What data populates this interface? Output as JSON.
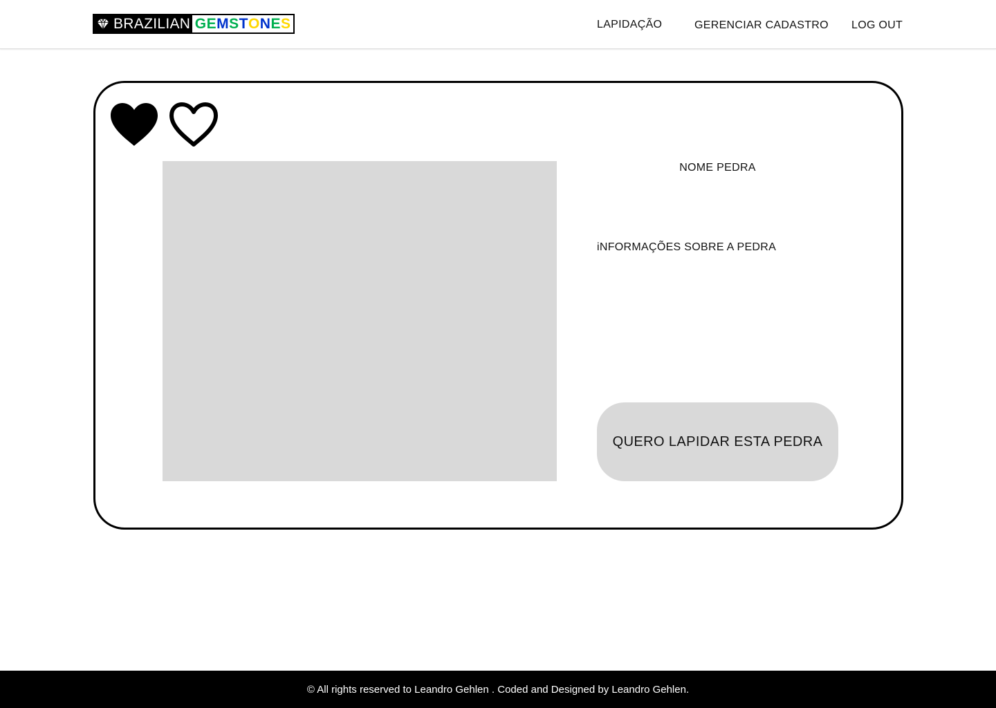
{
  "brand": {
    "word_left": "BRAZILIAN",
    "word_right_letters": [
      {
        "char": "G",
        "color": "#00b050"
      },
      {
        "char": "E",
        "color": "#00b050"
      },
      {
        "char": "M",
        "color": "#0033cc"
      },
      {
        "char": "S",
        "color": "#00b050"
      },
      {
        "char": "T",
        "color": "#0033cc"
      },
      {
        "char": "O",
        "color": "#ffd800"
      },
      {
        "char": "N",
        "color": "#0033cc"
      },
      {
        "char": "E",
        "color": "#00b050"
      },
      {
        "char": "S",
        "color": "#ffd800"
      }
    ],
    "icon": "diamond-icon"
  },
  "nav": {
    "lapidacao": "LAPIDAÇÃO",
    "gerenciar": "GERENCIAR CADASTRO",
    "logout": "LOG OUT"
  },
  "card": {
    "favorite_filled_icon": "heart-filled-icon",
    "favorite_outline_icon": "heart-outline-icon",
    "stone_name": "NOME PEDRA",
    "stone_info": "iNFORMAÇÕES SOBRE A PEDRA",
    "cta_label": "QUERO LAPIDAR ESTA PEDRA",
    "image_placeholder_color": "#d9d9d9"
  },
  "footer": {
    "text": "© All rights reserved to Leandro Gehlen . Coded  and Designed by Leandro Gehlen."
  }
}
